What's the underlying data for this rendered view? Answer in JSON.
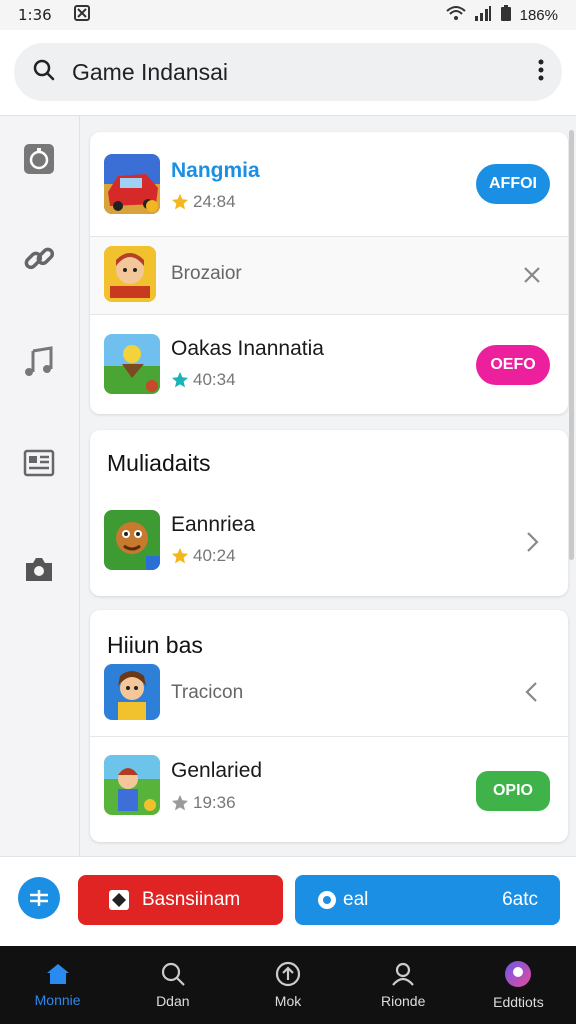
{
  "status_bar": {
    "time": "1:36",
    "battery": "186%",
    "notif_icon": "grid-icon"
  },
  "search": {
    "text": "Game Indansai"
  },
  "sidebar": {
    "icons": [
      "timer-icon",
      "link-icon",
      "music-note-icon",
      "news-icon",
      "camera-icon"
    ]
  },
  "card1": {
    "rows": [
      {
        "name": "Nangmia",
        "rating": "24:84",
        "button": "AFFOI",
        "button_color": "#1a8fe3",
        "name_color": "#1a8fe3",
        "star_color": "#f3b71d"
      },
      {
        "name": "Brozaior",
        "action_icon": "close-icon"
      },
      {
        "name": "Oakas Inannatia",
        "rating": "40:34",
        "button": "OEFO",
        "button_color": "#ec1f9d",
        "star_color": "#19b3b8"
      }
    ]
  },
  "card2": {
    "title": "Muliadaits",
    "rows": [
      {
        "name": "Eannriea",
        "rating": "40:24",
        "action_icon": "chevron-right-icon",
        "star_color": "#f3b71d"
      }
    ]
  },
  "card3": {
    "title": "Hiiun bas",
    "rows": [
      {
        "name": "Tracicon",
        "action_icon": "chevron-left-icon"
      },
      {
        "name": "Genlaried",
        "rating": "19:36",
        "button": "OPIO",
        "button_color": "#3fb34a",
        "star_color": "#9a9a9a"
      }
    ]
  },
  "action_bar": {
    "red_button": "Basnsiinam",
    "blue_button_left": "eal",
    "blue_button_right": "6atc",
    "red_color": "#e02424",
    "blue_color": "#1a8fe3"
  },
  "bottom_nav": [
    {
      "label": "Monnie",
      "icon": "home-icon",
      "active": true
    },
    {
      "label": "Ddan",
      "icon": "search-icon",
      "active": false
    },
    {
      "label": "Mok",
      "icon": "upload-icon",
      "active": false
    },
    {
      "label": "Rionde",
      "icon": "person-icon",
      "active": false
    },
    {
      "label": "Eddtiots",
      "icon": "profile-avatar-icon",
      "active": false
    }
  ]
}
